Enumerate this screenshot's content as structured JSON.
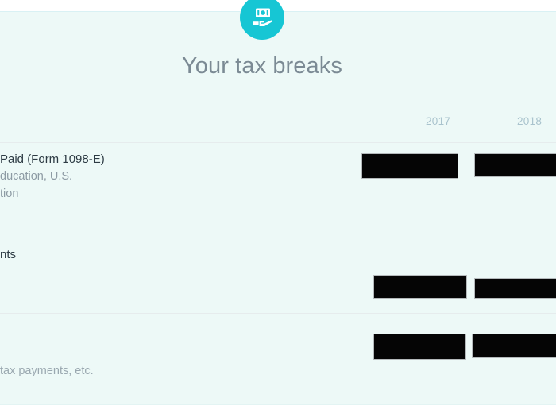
{
  "app": {
    "background_color": "#edf9f7",
    "accent_color": "#16c6d4"
  },
  "header": {
    "badge_icon": "cash-in-hand-icon",
    "title": "Your tax breaks"
  },
  "table": {
    "columns": [
      {
        "label": "2017"
      },
      {
        "label": "2018"
      }
    ],
    "rows": [
      {
        "label_main": "Paid (Form 1098-E)",
        "label_sub_1": "ducation, U.S.",
        "label_sub_2": "tion",
        "values": [
          {
            "redacted": true,
            "year": "2017"
          },
          {
            "redacted": true,
            "year": "2018"
          }
        ]
      },
      {
        "label_main": "nts",
        "label_sub_1": "",
        "label_sub_2": "",
        "values": [
          {
            "redacted": true,
            "year": "2017"
          },
          {
            "redacted": true,
            "year": "2018"
          }
        ]
      },
      {
        "label_main": "",
        "label_sub_1": "tax payments, etc.",
        "label_sub_2": "",
        "values": [
          {
            "redacted": true,
            "year": "2017"
          },
          {
            "redacted": true,
            "year": "2018"
          }
        ]
      }
    ]
  }
}
